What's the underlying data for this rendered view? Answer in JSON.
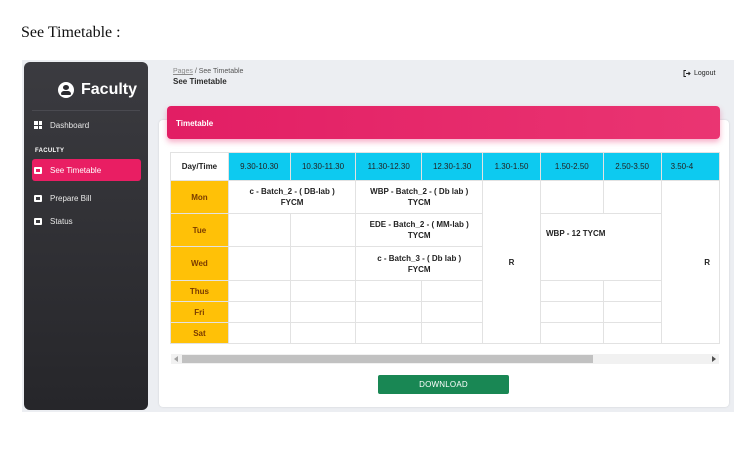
{
  "caption": "See Timetable :",
  "sidebar": {
    "brand": "Faculty",
    "items": [
      {
        "label": "Dashboard"
      },
      {
        "label": "See Timetable"
      },
      {
        "label": "Prepare Bill"
      },
      {
        "label": "Status"
      }
    ],
    "section": "FACULTY"
  },
  "header": {
    "breadcrumb_link": "Pages",
    "breadcrumb_current": "See Timetable",
    "title": "See Timetable",
    "logout": "Logout"
  },
  "card": {
    "title": "Timetable"
  },
  "timetable": {
    "corner": "Day/Time",
    "columns": [
      "9.30-10.30",
      "10.30-11.30",
      "11.30-12.30",
      "12.30-1.30",
      "1.30-1.50",
      "1.50-2.50",
      "2.50-3.50",
      "3.50-4"
    ],
    "days": [
      "Mon",
      "Tue",
      "Wed",
      "Thus",
      "Fri",
      "Sat"
    ],
    "mon_1": "c - Batch_2 - ( DB-lab )",
    "mon_1b": "FYCM",
    "mon_2": "WBP - Batch_2 - ( Db lab )",
    "mon_2b": "TYCM",
    "tue_2": "EDE - Batch_2 - ( MM-lab )",
    "tue_2b": "TYCM",
    "tue_3": "WBP - 12 TYCM",
    "wed_2": "c - Batch_3 - ( Db lab )",
    "wed_2b": "FYCM",
    "recess": "R",
    "recess2": "R"
  },
  "download": "DOWNLOAD",
  "colors": {
    "accent": "#e91e63",
    "header_row": "#0dcaf0",
    "day_column": "#ffc107",
    "download": "#198754"
  }
}
